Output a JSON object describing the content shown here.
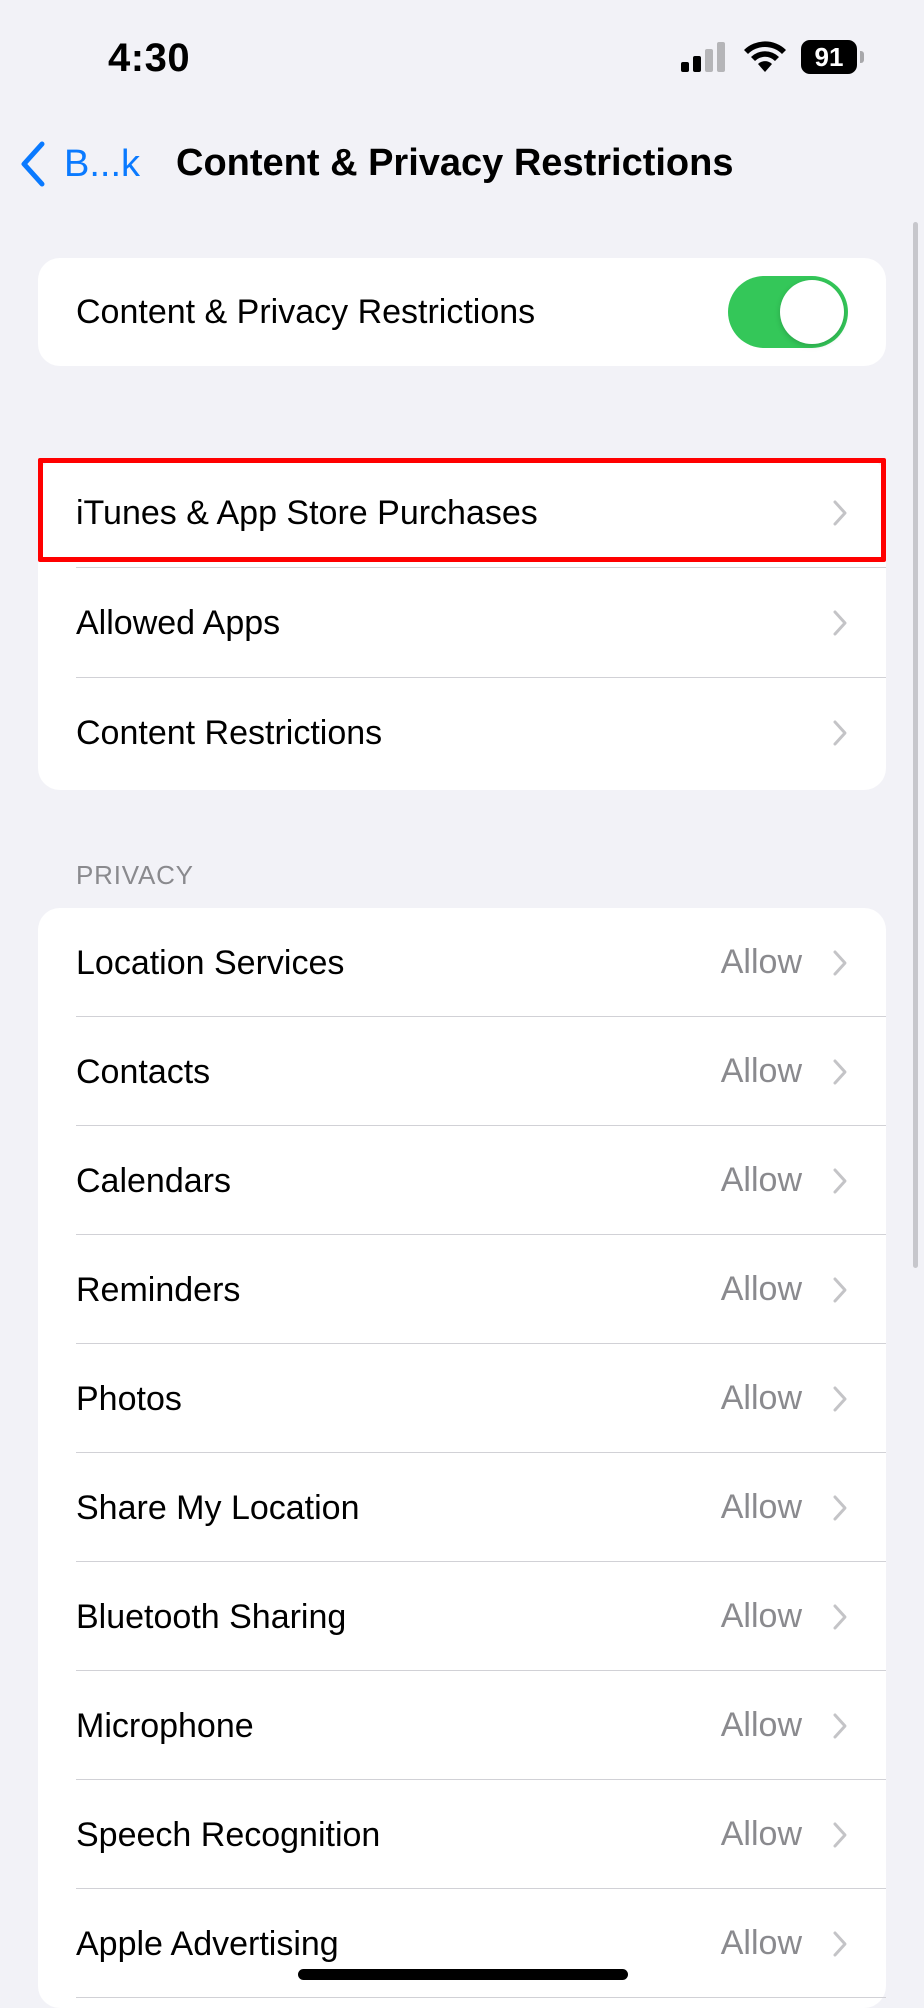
{
  "status_bar": {
    "time": "4:30",
    "battery": "91"
  },
  "nav": {
    "back_label": "B...k",
    "title": "Content & Privacy Restrictions"
  },
  "main_toggle": {
    "label": "Content & Privacy Restrictions",
    "enabled": true
  },
  "nav_group": {
    "items": [
      {
        "label": "iTunes & App Store Purchases",
        "highlighted": true
      },
      {
        "label": "Allowed Apps"
      },
      {
        "label": "Content Restrictions"
      }
    ]
  },
  "privacy": {
    "header": "PRIVACY",
    "items": [
      {
        "label": "Location Services",
        "value": "Allow"
      },
      {
        "label": "Contacts",
        "value": "Allow"
      },
      {
        "label": "Calendars",
        "value": "Allow"
      },
      {
        "label": "Reminders",
        "value": "Allow"
      },
      {
        "label": "Photos",
        "value": "Allow"
      },
      {
        "label": "Share My Location",
        "value": "Allow"
      },
      {
        "label": "Bluetooth Sharing",
        "value": "Allow"
      },
      {
        "label": "Microphone",
        "value": "Allow"
      },
      {
        "label": "Speech Recognition",
        "value": "Allow"
      },
      {
        "label": "Apple Advertising",
        "value": "Allow"
      }
    ]
  },
  "colors": {
    "accent": "#0a7aff",
    "toggle_on": "#34c759",
    "highlight": "#ff0000",
    "secondary_text": "#8a8a8e",
    "background": "#f2f2f7"
  },
  "icons": {
    "back": "chevron-left-icon",
    "row_disclosure": "chevron-right-icon",
    "signal": "cellular-signal-icon",
    "wifi": "wifi-icon",
    "battery": "battery-icon"
  }
}
